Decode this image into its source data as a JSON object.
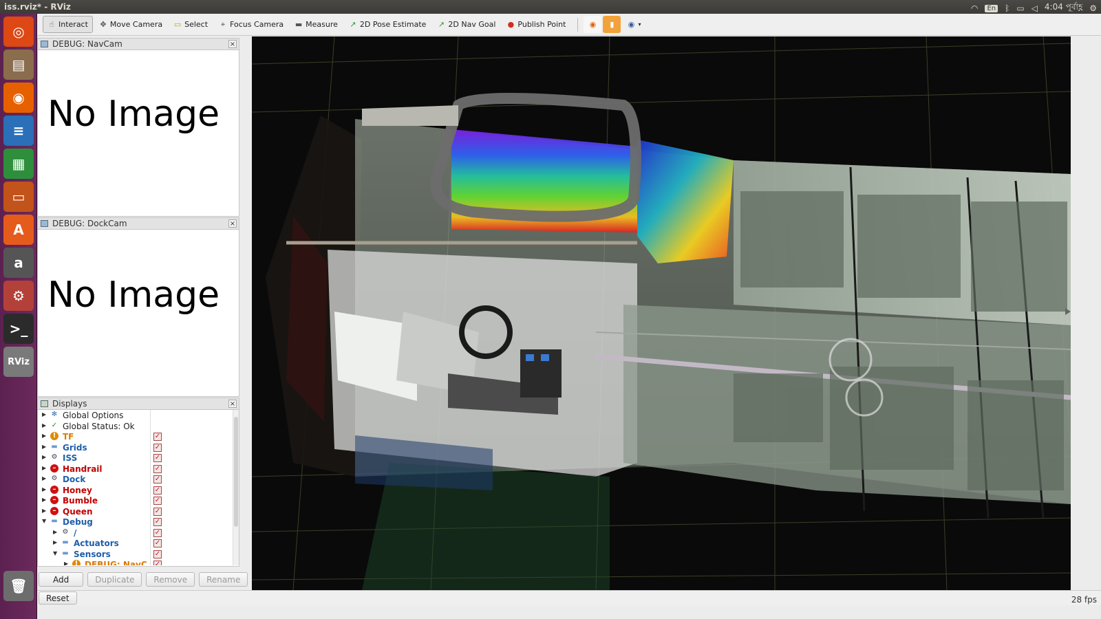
{
  "window": {
    "title": "iss.rviz* - RViz"
  },
  "system_tray": {
    "language": "En",
    "clock": "4:04 পূর্বাহ্ণ"
  },
  "toolbar": {
    "tools": [
      {
        "label": "Interact",
        "icon": "hand-icon",
        "active": true
      },
      {
        "label": "Move Camera",
        "icon": "move-camera-icon"
      },
      {
        "label": "Select",
        "icon": "select-icon"
      },
      {
        "label": "Focus Camera",
        "icon": "focus-camera-icon"
      },
      {
        "label": "Measure",
        "icon": "ruler-icon"
      },
      {
        "label": "2D Pose Estimate",
        "icon": "arrow-icon"
      },
      {
        "label": "2D Nav Goal",
        "icon": "arrow-icon"
      },
      {
        "label": "Publish Point",
        "icon": "pin-icon"
      }
    ]
  },
  "panels": {
    "navcam": {
      "title": "DEBUG: NavCam",
      "message": "No Image"
    },
    "dockcam": {
      "title": "DEBUG: DockCam",
      "message": "No Image"
    },
    "displays": {
      "title": "Displays"
    }
  },
  "displays_tree": [
    {
      "label": "Global Options",
      "color": "#222222",
      "weight": "normal",
      "indent": 0,
      "expanded": false,
      "icon": "gear-icon",
      "checkbox": false
    },
    {
      "label": "Global Status: Ok",
      "color": "#222222",
      "weight": "normal",
      "indent": 0,
      "expanded": false,
      "icon": "check-icon",
      "checkbox": false
    },
    {
      "label": "TF",
      "color": "#d97a00",
      "weight": "bold",
      "indent": 0,
      "expanded": false,
      "icon": "warning-icon",
      "checkbox": true
    },
    {
      "label": "Grids",
      "color": "#1f5fa8",
      "weight": "bold",
      "indent": 0,
      "expanded": false,
      "icon": "folder-icon",
      "checkbox": true
    },
    {
      "label": "ISS",
      "color": "#1f5fa8",
      "weight": "bold",
      "indent": 0,
      "expanded": false,
      "icon": "robot-icon",
      "checkbox": true
    },
    {
      "label": "Handrail",
      "color": "#c00000",
      "weight": "bold",
      "indent": 0,
      "expanded": false,
      "icon": "error-icon",
      "checkbox": true
    },
    {
      "label": "Dock",
      "color": "#1f5fa8",
      "weight": "bold",
      "indent": 0,
      "expanded": false,
      "icon": "robot-icon",
      "checkbox": true
    },
    {
      "label": "Honey",
      "color": "#c00000",
      "weight": "bold",
      "indent": 0,
      "expanded": false,
      "icon": "error-icon",
      "checkbox": true
    },
    {
      "label": "Bumble",
      "color": "#c00000",
      "weight": "bold",
      "indent": 0,
      "expanded": false,
      "icon": "error-icon",
      "checkbox": true
    },
    {
      "label": "Queen",
      "color": "#c00000",
      "weight": "bold",
      "indent": 0,
      "expanded": false,
      "icon": "error-icon",
      "checkbox": true
    },
    {
      "label": "Debug",
      "color": "#1f5fa8",
      "weight": "bold",
      "indent": 0,
      "expanded": true,
      "icon": "folder-icon",
      "checkbox": true
    },
    {
      "label": "/",
      "color": "#1f5fa8",
      "weight": "bold",
      "indent": 1,
      "expanded": false,
      "icon": "robot-icon",
      "checkbox": true
    },
    {
      "label": "Actuators",
      "color": "#1f5fa8",
      "weight": "bold",
      "indent": 1,
      "expanded": false,
      "icon": "folder-icon",
      "checkbox": true
    },
    {
      "label": "Sensors",
      "color": "#1f5fa8",
      "weight": "bold",
      "indent": 1,
      "expanded": true,
      "icon": "folder-icon",
      "checkbox": true
    },
    {
      "label": "DEBUG: NavC",
      "color": "#d97a00",
      "weight": "bold",
      "indent": 2,
      "expanded": false,
      "icon": "warning-icon",
      "checkbox": true
    }
  ],
  "display_buttons": {
    "add": "Add",
    "duplicate": "Duplicate",
    "remove": "Remove",
    "rename": "Rename"
  },
  "status_bar": {
    "reset": "Reset",
    "fps": "28 fps"
  },
  "launcher_items": [
    {
      "name": "ubuntu-icon",
      "glyph": "◎",
      "bg": "#dd4814"
    },
    {
      "name": "files-icon",
      "glyph": "▤",
      "bg": "#8a6d4c"
    },
    {
      "name": "firefox-icon",
      "glyph": "◉",
      "bg": "#e66000"
    },
    {
      "name": "writer-icon",
      "glyph": "≡",
      "bg": "#2a6fb8"
    },
    {
      "name": "calc-icon",
      "glyph": "▦",
      "bg": "#2d8f3c"
    },
    {
      "name": "impress-icon",
      "glyph": "▭",
      "bg": "#c2531a"
    },
    {
      "name": "software-center-icon",
      "glyph": "A",
      "bg": "#e55b1c"
    },
    {
      "name": "amazon-icon",
      "glyph": "a",
      "bg": "#555555"
    },
    {
      "name": "settings-icon",
      "glyph": "⚙",
      "bg": "#b3413a"
    },
    {
      "name": "terminal-icon",
      "glyph": ">_",
      "bg": "#2b2b2b"
    },
    {
      "name": "rviz-icon",
      "glyph": "RViz",
      "bg": "#7a7a7a"
    }
  ],
  "colors": {
    "launcher": "#6b2a5c",
    "viewport_bg": "#0a0a0a",
    "grid": "#5a5a3a"
  }
}
